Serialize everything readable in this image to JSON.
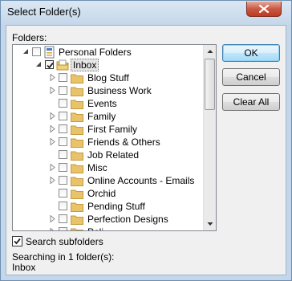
{
  "window": {
    "title": "Select Folder(s)"
  },
  "folders_label": "Folders:",
  "tree": {
    "root": {
      "label": "Personal Folders"
    },
    "inbox": {
      "label": "Inbox",
      "checked": true
    },
    "items": [
      {
        "label": "Blog Stuff",
        "expandable": true
      },
      {
        "label": "Business Work",
        "expandable": true
      },
      {
        "label": "Events",
        "expandable": false
      },
      {
        "label": "Family",
        "expandable": true
      },
      {
        "label": "First Family",
        "expandable": true
      },
      {
        "label": "Friends & Others",
        "expandable": true
      },
      {
        "label": "Job Related",
        "expandable": false
      },
      {
        "label": "Misc",
        "expandable": true
      },
      {
        "label": "Online Accounts - Emails",
        "expandable": true
      },
      {
        "label": "Orchid",
        "expandable": false
      },
      {
        "label": "Pending Stuff",
        "expandable": false
      },
      {
        "label": "Perfection Designs",
        "expandable": true
      },
      {
        "label": "Poli...",
        "expandable": true
      }
    ]
  },
  "buttons": {
    "ok": "OK",
    "cancel": "Cancel",
    "clear_all": "Clear All"
  },
  "search_subfolders": {
    "label": "Search subfolders",
    "checked": true
  },
  "status": {
    "line1": "Searching in 1 folder(s):",
    "line2": "Inbox"
  },
  "colors": {
    "folder": "#e8c36a",
    "default_button_border": "#3c7fb1",
    "close_button": "#c75a45"
  }
}
